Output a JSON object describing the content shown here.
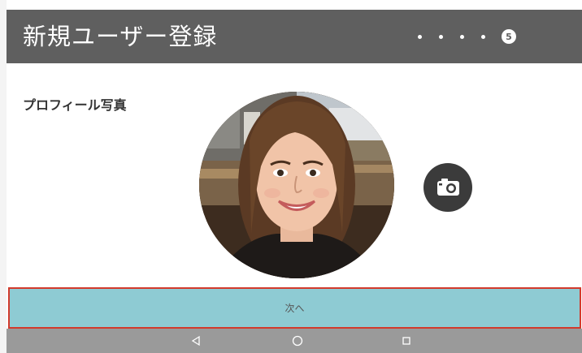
{
  "header": {
    "title": "新規ユーザー登録",
    "current_step": "5",
    "background_color": "#5f5f5f"
  },
  "profile": {
    "section_label": "プロフィール写真",
    "photo_icon": "profile-photo",
    "camera_icon": "camera-icon"
  },
  "footer": {
    "next_label": "次へ",
    "next_button_color": "#8ecbd3",
    "highlight_border_color": "#d23a2c"
  },
  "system_nav": {
    "back_icon": "back-triangle-icon",
    "home_icon": "home-circle-icon",
    "recents_icon": "recents-square-icon"
  }
}
